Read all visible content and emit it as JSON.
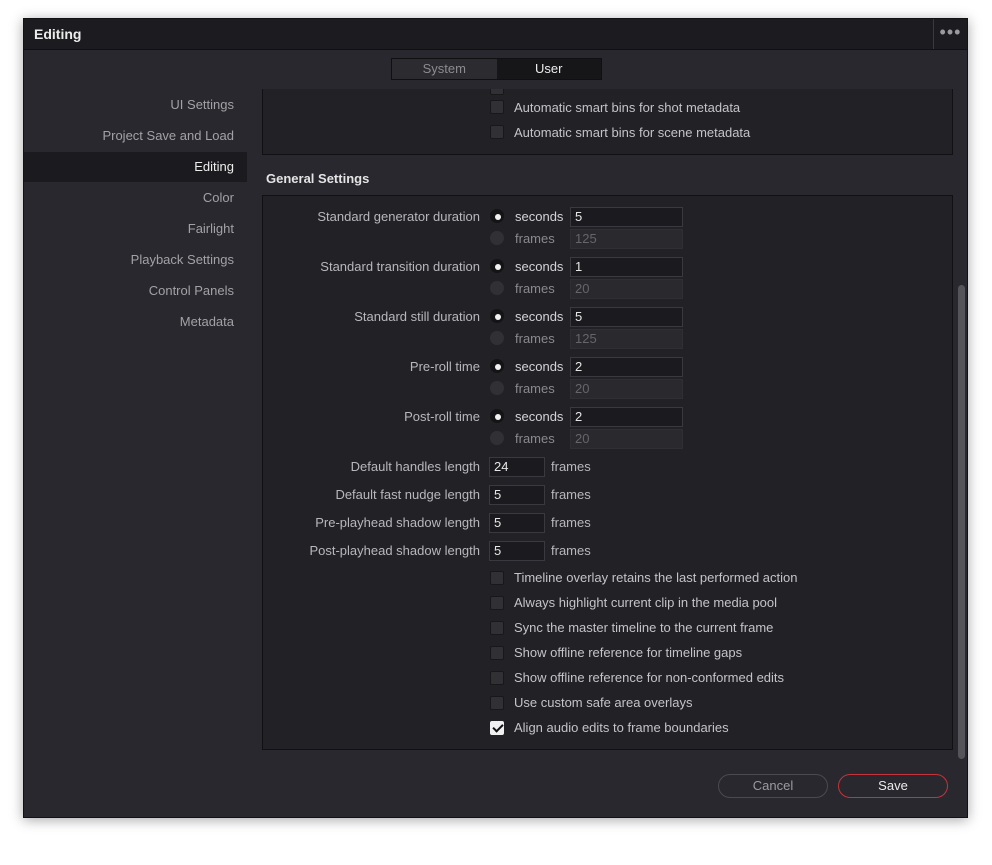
{
  "window": {
    "title": "Editing",
    "more_icon": "•••"
  },
  "tabs": {
    "system": "System",
    "user": "User",
    "active": "User"
  },
  "sidebar": {
    "items": [
      {
        "label": "UI Settings"
      },
      {
        "label": "Project Save and Load"
      },
      {
        "label": "Editing",
        "active": true
      },
      {
        "label": "Color"
      },
      {
        "label": "Fairlight"
      },
      {
        "label": "Playback Settings"
      },
      {
        "label": "Control Panels"
      },
      {
        "label": "Metadata"
      }
    ]
  },
  "smart_bins": {
    "items": [
      {
        "label": "Automatic smart bins for shot metadata",
        "checked": false
      },
      {
        "label": "Automatic smart bins for scene metadata",
        "checked": false
      }
    ]
  },
  "general": {
    "title": "General Settings",
    "durations": [
      {
        "label": "Standard generator duration",
        "seconds_label": "seconds",
        "seconds_value": "5",
        "frames_label": "frames",
        "frames_value": "125"
      },
      {
        "label": "Standard transition duration",
        "seconds_label": "seconds",
        "seconds_value": "1",
        "frames_label": "frames",
        "frames_value": "20"
      },
      {
        "label": "Standard still duration",
        "seconds_label": "seconds",
        "seconds_value": "5",
        "frames_label": "frames",
        "frames_value": "125"
      },
      {
        "label": "Pre-roll time",
        "seconds_label": "seconds",
        "seconds_value": "2",
        "frames_label": "frames",
        "frames_value": "20"
      },
      {
        "label": "Post-roll time",
        "seconds_label": "seconds",
        "seconds_value": "2",
        "frames_label": "frames",
        "frames_value": "20"
      }
    ],
    "lengths": [
      {
        "label": "Default handles length",
        "value": "24",
        "unit": "frames"
      },
      {
        "label": "Default fast nudge length",
        "value": "5",
        "unit": "frames"
      },
      {
        "label": "Pre-playhead shadow length",
        "value": "5",
        "unit": "frames"
      },
      {
        "label": "Post-playhead shadow length",
        "value": "5",
        "unit": "frames"
      }
    ],
    "options": [
      {
        "label": "Timeline overlay retains the last performed action",
        "checked": false
      },
      {
        "label": "Always highlight current clip in the media pool",
        "checked": false
      },
      {
        "label": "Sync the master timeline to the current frame",
        "checked": false
      },
      {
        "label": "Show offline reference for timeline gaps",
        "checked": false
      },
      {
        "label": "Show offline reference for non-conformed edits",
        "checked": false
      },
      {
        "label": "Use custom safe area overlays",
        "checked": false
      },
      {
        "label": "Align audio edits to frame boundaries",
        "checked": true
      }
    ]
  },
  "footer": {
    "cancel": "Cancel",
    "save": "Save"
  },
  "colors": {
    "save_border": "#c4343a",
    "background": "#28282e",
    "panel": "#222226"
  }
}
